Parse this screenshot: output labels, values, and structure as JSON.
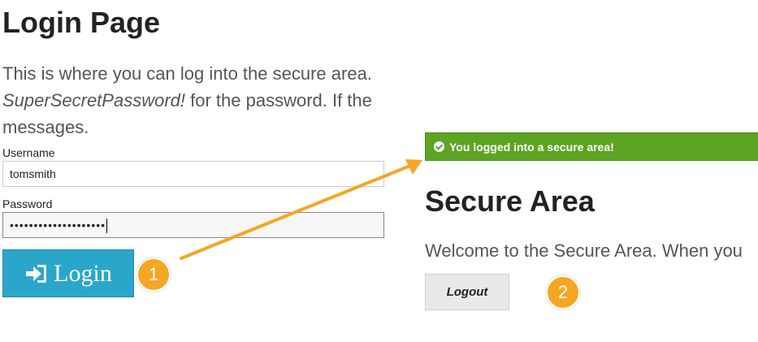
{
  "login_page": {
    "title": "Login Page",
    "intro_line1": "This is where you can log into the secure area.",
    "intro_line2_italic": "SuperSecretPassword!",
    "intro_line2_rest": " for the password. If the",
    "intro_line3": "messages.",
    "username_label": "Username",
    "username_value": "tomsmith",
    "password_label": "Password",
    "password_masked": "••••••••••••••••••••",
    "login_button_label": "Login",
    "step_badge": "1"
  },
  "secure_area": {
    "flash_message": "You logged into a secure area!",
    "title": "Secure Area",
    "welcome_text": "Welcome to the Secure Area. When you",
    "logout_button_label": "Logout",
    "step_badge": "2"
  },
  "colors": {
    "login_button": "#2ba6cb",
    "flash_success": "#5da423",
    "badge": "#f5a623",
    "arrow": "#f5a623"
  },
  "icons": {
    "login_icon": "sign-in-icon",
    "flash_icon": "check-circle-icon"
  }
}
